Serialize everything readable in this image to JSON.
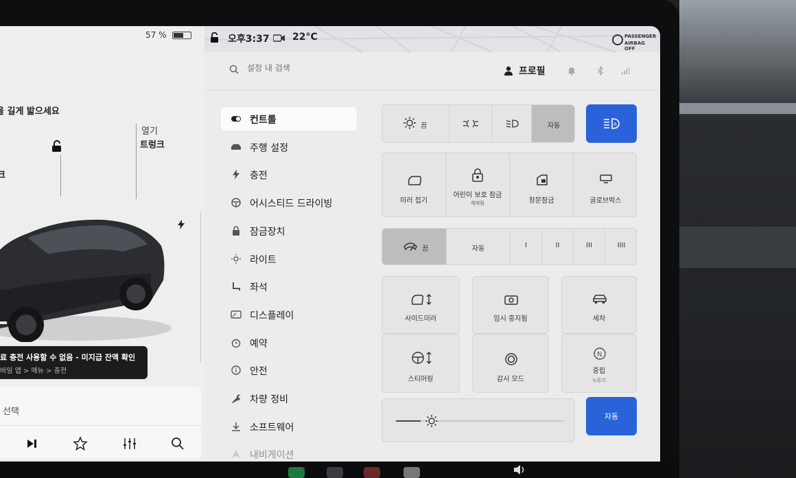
{
  "status_bar": {
    "battery_percent": "57 %",
    "battery_level": 0.57,
    "time": "오후3:37",
    "temperature": "22°C",
    "airbag_line1": "PASSENGER",
    "airbag_line2": "AIRBAG OFF"
  },
  "car_view": {
    "hint": "을 길게 밟으세요",
    "frunk_label": "크",
    "trunk_open": "열기",
    "trunk_label": "트렁크",
    "alert_title": "료 충전 사용할 수 없음 - 미지급 잔액 확인",
    "alert_path": "바일 앱 > 메뉴 > 충전"
  },
  "media": {
    "source": "선택",
    "controls": [
      "play-next-icon",
      "star-icon",
      "equalizer-icon",
      "search-icon"
    ]
  },
  "header": {
    "search_placeholder": "설정 내 검색",
    "profile_label": "프로필"
  },
  "menu": {
    "items": [
      {
        "label": "컨트롤",
        "icon": "toggle-icon",
        "selected": true
      },
      {
        "label": "주행 설정",
        "icon": "car-icon",
        "selected": false
      },
      {
        "label": "충전",
        "icon": "bolt-icon",
        "selected": false
      },
      {
        "label": "어시스티드 드라이빙",
        "icon": "steering-wheel-icon",
        "selected": false
      },
      {
        "label": "잠금장치",
        "icon": "lock-icon",
        "selected": false
      },
      {
        "label": "라이트",
        "icon": "sun-icon",
        "selected": false
      },
      {
        "label": "좌석",
        "icon": "seat-icon",
        "selected": false
      },
      {
        "label": "디스플레이",
        "icon": "display-icon",
        "selected": false
      },
      {
        "label": "예약",
        "icon": "alarm-icon",
        "selected": false
      },
      {
        "label": "안전",
        "icon": "info-circle-icon",
        "selected": false
      },
      {
        "label": "차량 정비",
        "icon": "wrench-icon",
        "selected": false
      },
      {
        "label": "소프트웨어",
        "icon": "download-icon",
        "selected": false
      },
      {
        "label": "내비게이션",
        "icon": "navigation-icon",
        "selected": false
      }
    ]
  },
  "lights": {
    "off_label": "끔",
    "auto_label": "자동",
    "selected": "자동"
  },
  "quick_controls": {
    "mirror_fold": "미러 접기",
    "child_lock": "어린이 보호 잠금",
    "child_lock_sub": "해제됨",
    "window_lock": "창문잠금",
    "glovebox": "글로브박스"
  },
  "wipers": {
    "off_label": "끔",
    "auto_label": "자동",
    "speeds": [
      "I",
      "II",
      "III",
      "IIII"
    ],
    "selected": "끔"
  },
  "adjust": {
    "side_mirror": "사이드미러",
    "steering": "스티어링",
    "temp_stop": "임시 중지됨",
    "focus_mode": "감시 모드",
    "car_wash": "세차",
    "park": "중립",
    "park_sub": "누르기"
  },
  "brightness": {
    "auto_label": "자동",
    "level": 0.05
  },
  "colors": {
    "accent_blue": "#2a63d9",
    "selected_gray": "#bdbdbd"
  }
}
